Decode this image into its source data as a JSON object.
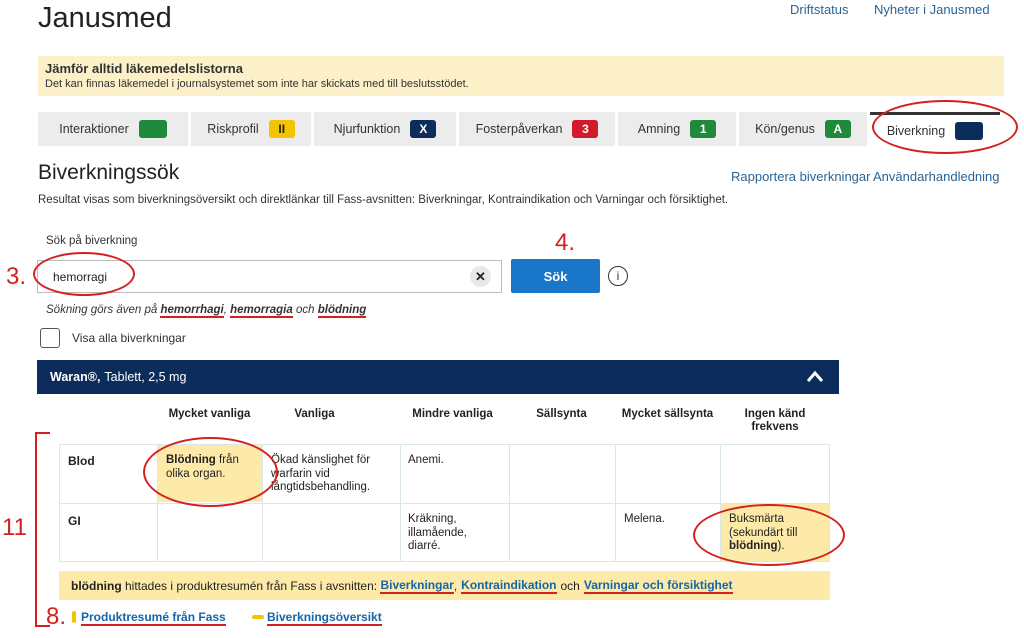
{
  "header": {
    "site_title": "Janusmed",
    "links": [
      "Driftstatus",
      "Nyheter i Janusmed"
    ]
  },
  "notice": {
    "title": "Jämför alltid läkemedelslistorna",
    "text": "Det kan finnas läkemedel i journalsystemet som inte har skickats med till beslutsstödet."
  },
  "tabs": [
    {
      "label": "Interaktioner",
      "badge": "",
      "color": "#1f8a3b"
    },
    {
      "label": "Riskprofil",
      "badge": "II",
      "color": "#f5c400"
    },
    {
      "label": "Njurfunktion",
      "badge": "X",
      "color": "#0c2d5c"
    },
    {
      "label": "Fosterpåverkan",
      "badge": "3",
      "color": "#d01c2a"
    },
    {
      "label": "Amning",
      "badge": "1",
      "color": "#1f8a3b"
    },
    {
      "label": "Kön/genus",
      "badge": "A",
      "color": "#1f8a3b"
    },
    {
      "label": "Biverkning",
      "badge": "",
      "color": "#0c2d5c"
    }
  ],
  "section": {
    "title": "Biverkningssök",
    "links": [
      "Rapportera biverkningar",
      "Användarhandledning"
    ],
    "description": "Resultat visas som biverkningsöversikt och direktlänkar till Fass-avsnitten: Biverkningar, Kontraindikation och Varningar och försiktighet."
  },
  "search": {
    "label": "Sök på biverkning",
    "value": "hemorragi",
    "clear": "✕",
    "button": "Sök",
    "info": "i",
    "also_prefix": "Sökning görs även på",
    "also_terms": [
      "hemorrhagi",
      "hemorragia",
      "blödning"
    ],
    "also_sep": ",",
    "also_and": "och",
    "show_all_label": "Visa alla biverkningar"
  },
  "drug": {
    "name": "Waran®,",
    "detail": "Tablett, 2,5 mg"
  },
  "table": {
    "columns": [
      "Mycket vanliga",
      "Vanliga",
      "Mindre vanliga",
      "Sällsynta",
      "Mycket sällsynta",
      "Ingen känd frekvens"
    ],
    "rows": [
      {
        "label": "Blod",
        "cells": [
          {
            "bold": "Blödning",
            "text": " från olika organ."
          },
          {
            "bold": "",
            "text": "Ökad känslighet för warfarin vid långtidsbehandling."
          },
          {
            "bold": "",
            "text": "Anemi."
          },
          {
            "bold": "",
            "text": ""
          },
          {
            "bold": "",
            "text": ""
          },
          {
            "bold": "",
            "text": ""
          }
        ]
      },
      {
        "label": "GI",
        "cells": [
          {
            "bold": "",
            "text": ""
          },
          {
            "bold": "",
            "text": ""
          },
          {
            "bold": "",
            "text": "Kräkning, illamående, diarré."
          },
          {
            "bold": "",
            "text": ""
          },
          {
            "bold": "",
            "text": "Melena."
          },
          {
            "bold": "",
            "pre": "Buksmärta (sekundärt till ",
            "text": "blödning",
            "post": ")."
          }
        ]
      }
    ]
  },
  "result": {
    "term": "blödning",
    "text": " hittades i produktresumén från Fass i avsnitten: ",
    "link1": "Biverkningar",
    "sep": ",",
    "link2": "Kontraindikation",
    "and": "och",
    "link3": "Varningar och försiktighet"
  },
  "bottom_links": [
    "Produktresumé från Fass",
    "Biverkningsöversikt"
  ],
  "annotations": {
    "n3": "3.",
    "n4": "4.",
    "n8": "8.",
    "n11": "11"
  }
}
